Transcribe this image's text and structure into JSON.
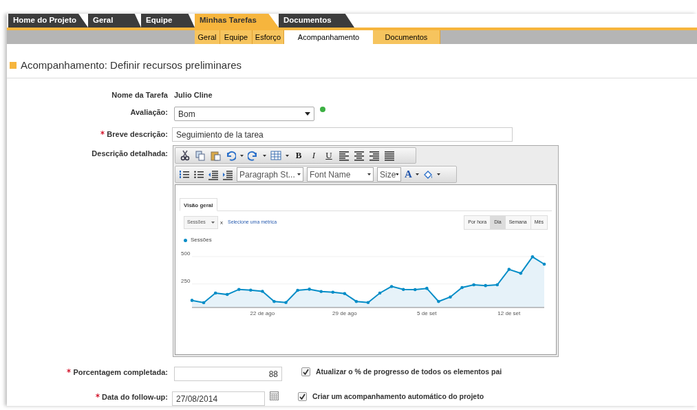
{
  "main_tabs": [
    {
      "label": "Home do Projeto",
      "selected": false
    },
    {
      "label": "Geral",
      "selected": false
    },
    {
      "label": "Equipe",
      "selected": false
    },
    {
      "label": "Minhas Tarefas",
      "selected": true
    },
    {
      "label": "Documentos",
      "selected": false
    }
  ],
  "sub_tabs": [
    {
      "label": "Geral",
      "selected": false
    },
    {
      "label": "Equipe",
      "selected": false
    },
    {
      "label": "Esforço",
      "selected": false
    },
    {
      "label": "Acompanhamento",
      "selected": true
    },
    {
      "label": "Documentos",
      "selected": false
    }
  ],
  "page_title": "Acompanhamento: Definir recursos preliminares",
  "task_name": {
    "label": "Nome da Tarefa",
    "value": "Julio Cline"
  },
  "rating": {
    "label": "Avaliação:",
    "value": "Bom",
    "color": "#3cb043"
  },
  "short_description": {
    "label": "Breve descrição:",
    "required": true,
    "value": "Seguimiento de la tarea"
  },
  "detailed_description": {
    "label": "Descrição detalhada:",
    "format_buttons": [
      "B",
      "I",
      "U"
    ],
    "dropdowns": [
      "Paragraph St...",
      "Font Name",
      "Size"
    ],
    "font_color_button": "A",
    "content": {
      "tab": "Visão geral",
      "metric_dropdown": "Sessões",
      "remove": "x",
      "metric_link": "Selecione uma métrica",
      "periods": [
        {
          "label": "Por hora",
          "selected": false
        },
        {
          "label": "Dia",
          "selected": true
        },
        {
          "label": "Semana",
          "selected": false
        },
        {
          "label": "Mês",
          "selected": false
        }
      ],
      "x_axis_labels": [
        "22 de ago",
        "29 de ago",
        "5 de set",
        "12 de set"
      ],
      "chart_data": {
        "type": "area",
        "series": [
          {
            "name": "Sessões",
            "color": "#058dc7",
            "values": [
              100,
              79,
              167,
              154,
              200,
              194,
              183,
              90,
              81,
              192,
              202,
              181,
              175,
              162,
              90,
              81,
              167,
              227,
              200,
              198,
              210,
              90,
              131,
              217,
              242,
              235,
              242,
              383,
              348,
              498,
              431
            ]
          }
        ],
        "ylim": [
          35,
          500
        ],
        "yticks": [
          250,
          500
        ]
      }
    }
  },
  "percent_complete": {
    "label": "Porcentagem completada:",
    "required": true,
    "value": "88",
    "checkbox": {
      "label": "Atualizar o % de progresso de todos os elementos pai",
      "checked": true
    }
  },
  "follow_up_date": {
    "label": "Data do follow-up:",
    "required": true,
    "value": "27/08/2014",
    "checkbox": {
      "label": "Criar um acompanhamento automático do projeto",
      "checked": true
    }
  }
}
